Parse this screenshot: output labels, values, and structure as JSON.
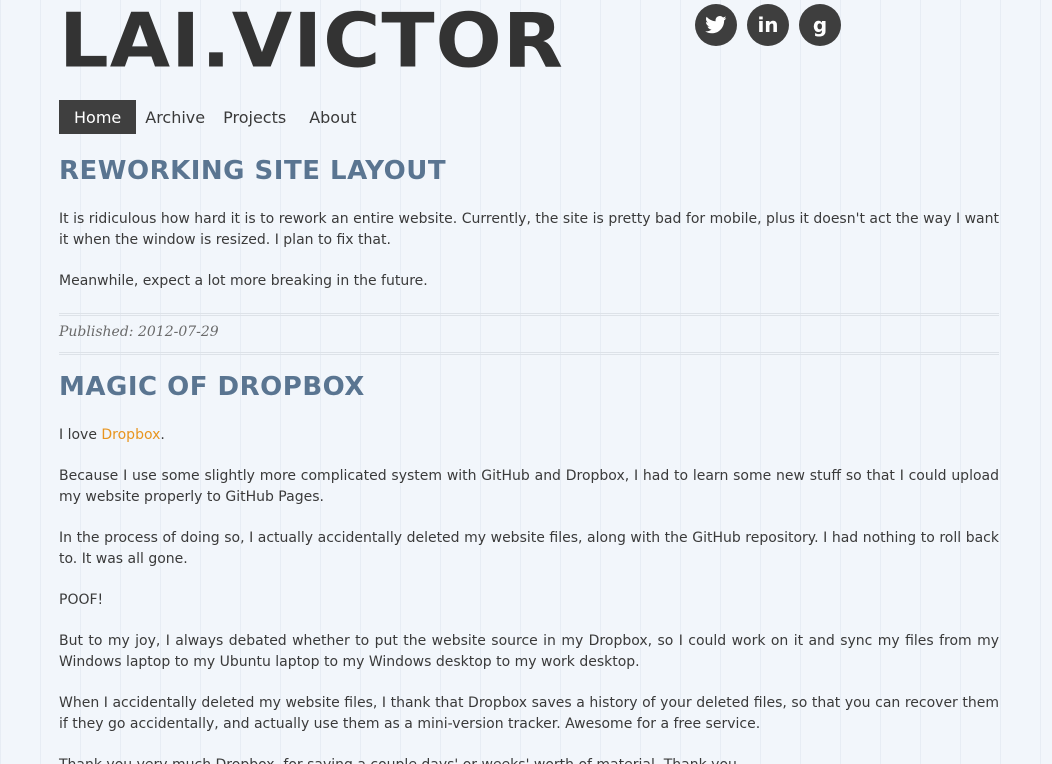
{
  "header": {
    "site_title": "LAI.VICTOR",
    "social": [
      {
        "icon": "twitter-icon",
        "label": ""
      },
      {
        "icon": "linkedin-icon",
        "label": "in"
      },
      {
        "icon": "google-icon",
        "label": "g"
      }
    ]
  },
  "nav": {
    "items": [
      {
        "label": "Home",
        "active": true
      },
      {
        "label": "Archive",
        "active": false
      },
      {
        "label": "Projects",
        "active": false
      },
      {
        "label": "About",
        "active": false
      }
    ]
  },
  "posts": [
    {
      "title": "Reworking Site Layout",
      "paragraphs": [
        "It is ridiculous how hard it is to rework an entire website. Currently, the site is pretty bad for mobile, plus it doesn't act the way I want it when the window is resized. I plan to fix that.",
        "Meanwhile, expect a lot more breaking in the future."
      ],
      "published": "Published: 2012-07-29"
    },
    {
      "title": "Magic of Dropbox",
      "intro_prefix": "I love ",
      "intro_link": "Dropbox",
      "intro_suffix": ".",
      "paragraphs": [
        "Because I use some slightly more complicated system with GitHub and Dropbox, I had to learn some new stuff so that I could upload my website properly to GitHub Pages.",
        "In the process of doing so, I actually accidentally deleted my website files, along with the GitHub repository. I had nothing to roll back to. It was all gone.",
        "POOF!",
        "But to my joy, I always debated whether to put the website source in my Dropbox, so I could work on it and sync my files from my Windows laptop to my Ubuntu laptop to my Windows desktop to my work desktop.",
        "When I accidentally deleted my website files, I thank that Dropbox saves a history of your deleted files, so that you can recover them if they go accidentally, and actually use them as a mini-version tracker. Awesome for a free service.",
        "Thank you very much Dropbox, for saving a couple days' or weeks' worth of material. Thank you."
      ]
    }
  ],
  "colors": {
    "background": "#f2f6fb",
    "title_text": "#333333",
    "post_title": "#5a7591",
    "link": "#e8951f",
    "nav_active_bg": "#3f3f3f"
  }
}
